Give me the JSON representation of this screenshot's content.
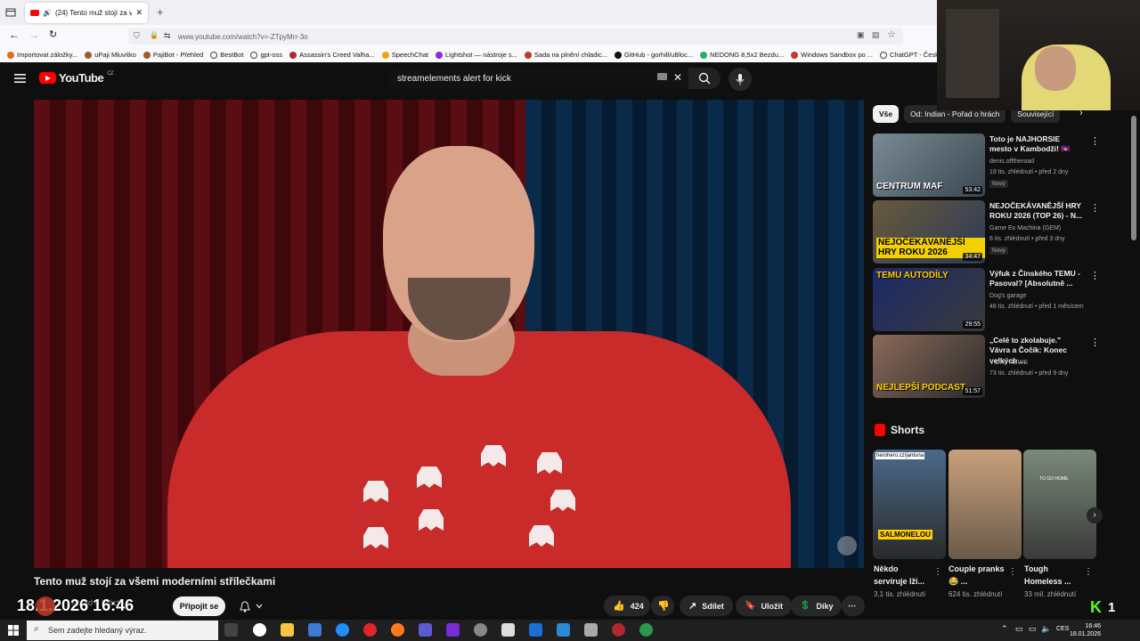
{
  "browser": {
    "tab_title": "(24) Tento muž stojí za všemi",
    "url": "www.youtube.com/watch?v=-ZTpyMrr-3o",
    "bookmarks": [
      "Importovat záložky...",
      "uPaji Mluvítko",
      "PajiBot - Přehled",
      "BestBot",
      "gpt-oss",
      "Assassin's Creed Valha...",
      "SpeechChat",
      "Lightshot — nástroje s...",
      "Sada na plnění chladic...",
      "GitHub - gorhill/uBloc...",
      "NEDONG 8,5x2 Bezdu...",
      "Windows Sandbox po ...",
      "ChatGPT - Česky"
    ]
  },
  "youtube": {
    "logo_text": "YouTube",
    "country": "CZ",
    "search_query": "streamelements alert for kick"
  },
  "video": {
    "title": "Tento muž stojí za všemi moderními střílečkami",
    "channel": "Pořad o hrách",
    "join_label": "Připojit se",
    "likes": "424",
    "share_label": "Sdílet",
    "save_label": "Uložit",
    "thanks_label": "Díky"
  },
  "overlay": {
    "datetime": "18.1.2026 16:46",
    "kick_count": "1",
    "kick_logo": "K"
  },
  "sidebar": {
    "chips": [
      "Vše",
      "Od: Indian - Pořad o hrách",
      "Související"
    ],
    "recommendations": [
      {
        "title": "Toto je NAJHORSIE mesto v Kambodži! 🇰🇭",
        "channel": "denis.offtheroad",
        "meta": "19 tis. zhlédnutí • před 2 dny",
        "badge": "Nový",
        "duration": "53:42",
        "thumb_text": "CENTRUM MAF"
      },
      {
        "title": "NEJOČEKÁVANĚJŠÍ HRY ROKU 2026 (TOP 26) - N...",
        "channel": "Game Ex Machina (GEM)",
        "meta": "6 tis. zhlédnutí • před 3 dny",
        "badge": "Nový",
        "duration": "34:47",
        "thumb_text": "NEJOČEKÁVANĚJŠÍ HRY ROKU 2026"
      },
      {
        "title": "Výfuk z Čínského TEMU - Pasoval? [Absolutně ...",
        "channel": "Dog's garage",
        "meta": "48 tis. zhlédnutí • před 1 měsícem",
        "badge": "",
        "duration": "29:55",
        "thumb_text": "TEMU AUTODÍLY"
      },
      {
        "title": "„Celé to zkolabuje.\" Vávra a Čočík: Konec velkých ...",
        "channel": "V.O.X. NEWS",
        "meta": "73 tis. zhlédnutí • před 9 dny",
        "badge": "",
        "duration": "51:57",
        "thumb_text": "NEJLEPŠÍ PODCAST"
      }
    ],
    "shorts_heading": "Shorts",
    "shorts": [
      {
        "title": "Někdo servíruje lži...",
        "views": "3,1 tis. zhlédnutí",
        "thumb_text": "SALMONELOU",
        "thumb_top": "herohero.cz/jantuna"
      },
      {
        "title": "Couple pranks 😂 ...",
        "views": "624 tis. zhlédnutí",
        "thumb_text": "",
        "thumb_top": ""
      },
      {
        "title": "Tough Homeless ...",
        "views": "33 mil. zhlédnutí",
        "thumb_text": "",
        "thumb_top": "TO GO HOME"
      }
    ]
  },
  "taskbar": {
    "search_placeholder": "Sem zadejte hledaný výraz.",
    "language": "CES",
    "time": "16:46",
    "date": "18.01.2026"
  }
}
